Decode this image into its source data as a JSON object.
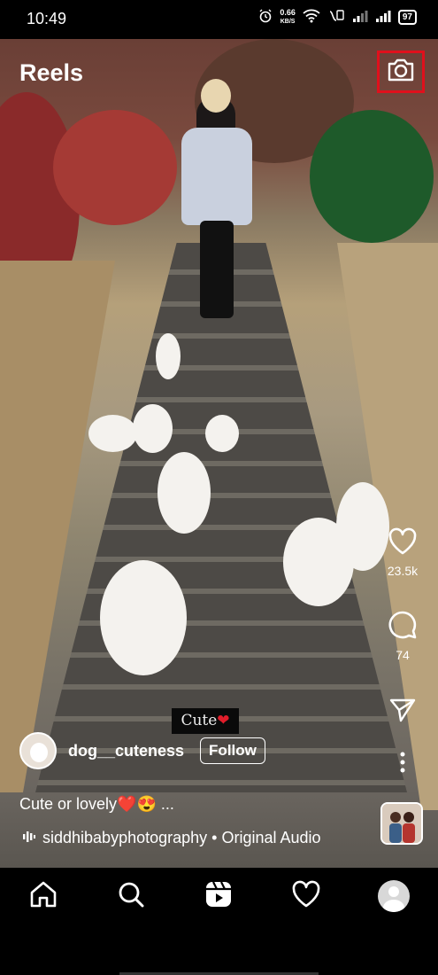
{
  "status_bar": {
    "time": "10:49",
    "net_speed_value": "0.66",
    "net_speed_unit": "KB/S",
    "battery": "97",
    "icons": [
      "alarm-icon",
      "wifi-icon",
      "volte-icon",
      "signal-icon",
      "signal-icon",
      "battery-icon"
    ]
  },
  "header": {
    "title": "Reels",
    "camera_icon": "camera-icon",
    "highlight_color": "#e0101c"
  },
  "actions": {
    "like_count": "23.5k",
    "comment_count": "74",
    "icons": [
      "heart-icon",
      "comment-icon",
      "send-icon",
      "more-icon"
    ]
  },
  "video": {
    "overlay_text": "Cute",
    "overlay_emoji": "❤"
  },
  "author": {
    "username": "dog__cuteness",
    "follow_label": "Follow"
  },
  "caption": {
    "text": "Cute or lovely❤️😍 ..."
  },
  "audio": {
    "text": "siddhibabyphotography • Original Audio"
  },
  "nav": {
    "items": [
      "home-icon",
      "search-icon",
      "reels-icon",
      "heart-icon",
      "profile-avatar"
    ]
  }
}
